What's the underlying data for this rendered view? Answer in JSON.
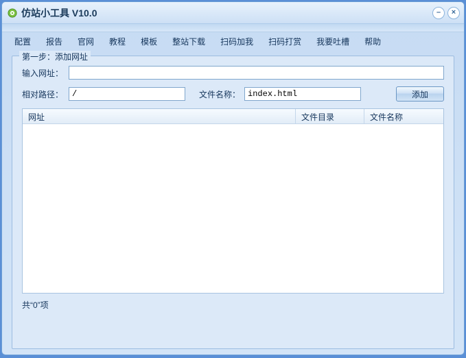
{
  "title": "仿站小工具 V10.0",
  "menu": [
    "配置",
    "报告",
    "官网",
    "教程",
    "模板",
    "整站下载",
    "扫码加我",
    "扫码打赏",
    "我要吐槽",
    "帮助"
  ],
  "group_title": "第一步：添加网址",
  "labels": {
    "url": "输入网址：",
    "path": "相对路径：",
    "file": "文件名称："
  },
  "inputs": {
    "url": "",
    "path": "/",
    "file": "index.html"
  },
  "add_btn": "添加",
  "columns": {
    "c1": "网址",
    "c2": "文件目录",
    "c3": "文件名称"
  },
  "count_text": "共“0”项"
}
